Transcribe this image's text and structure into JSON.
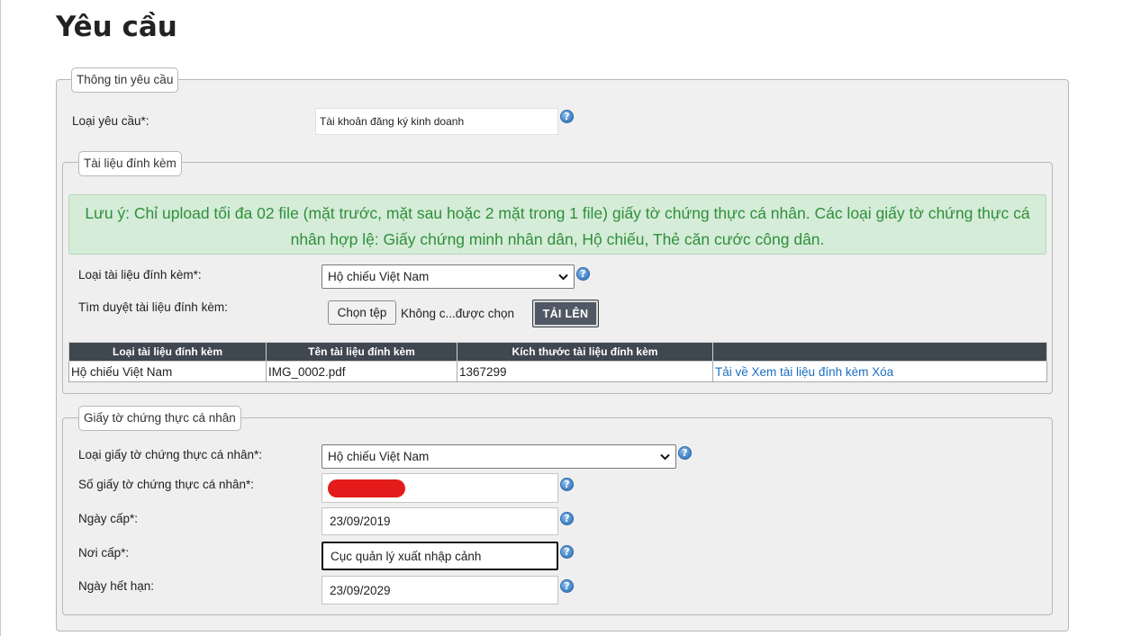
{
  "page": {
    "title": "Yêu cầu"
  },
  "request_info": {
    "legend": "Thông tin yêu cầu",
    "type_label": "Loại yêu cầu*:",
    "type_value": "Tài khoản đăng ký kinh doanh"
  },
  "attachments": {
    "legend": "Tài liệu đính kèm",
    "notice": "Lưu ý: Chỉ upload tối đa 02 file (mặt trước, mặt sau hoặc 2 mặt trong 1 file) giấy tờ chứng thực cá nhân. Các loại giấy tờ chứng thực cá nhân hợp lệ: Giấy chứng minh nhân dân, Hộ chiếu, Thẻ căn cước công dân.",
    "doc_type_label": "Loại tài liệu đính kèm*:",
    "doc_type_value": "Hộ chiếu Việt Nam",
    "browse_label": "Tìm duyệt tài liệu đính kèm:",
    "choose_file_button": "Chọn tệp",
    "no_file_text": "Không c...được chọn",
    "upload_button": "TẢI LÊN",
    "table": {
      "headers": [
        "Loại tài liệu đính kèm",
        "Tên tài liệu đính kèm",
        "Kích thước tài liệu đính kèm",
        ""
      ],
      "rows": [
        {
          "type": "Hộ chiếu Việt Nam",
          "name": "IMG_0002.pdf",
          "size": "1367299",
          "actions": [
            "Tải về",
            "Xem tài liệu đính kèm",
            "Xóa"
          ]
        }
      ]
    }
  },
  "personal_doc": {
    "legend": "Giấy tờ chứng thực cá nhân",
    "type_label": "Loại giấy tờ chứng thực cá nhân*:",
    "type_value": "Hộ chiếu Việt Nam",
    "number_label": "Số giấy tờ chứng thực cá nhân*:",
    "number_value": "",
    "issue_date_label": "Ngày cấp*:",
    "issue_date_value": "23/09/2019",
    "issue_place_label": "Nơi cấp*:",
    "issue_place_value": "Cục quản lý xuất nhập cảnh",
    "expiry_label": "Ngày hết hạn:",
    "expiry_value": "23/09/2029"
  },
  "icons": {
    "help": "?",
    "dropdown": "⌄"
  },
  "colors": {
    "notice_bg": "#d5ecd8",
    "notice_text": "#2f8f3b",
    "table_header": "#3f4750",
    "link": "#1a6fc2",
    "redaction": "#e31b1b"
  }
}
